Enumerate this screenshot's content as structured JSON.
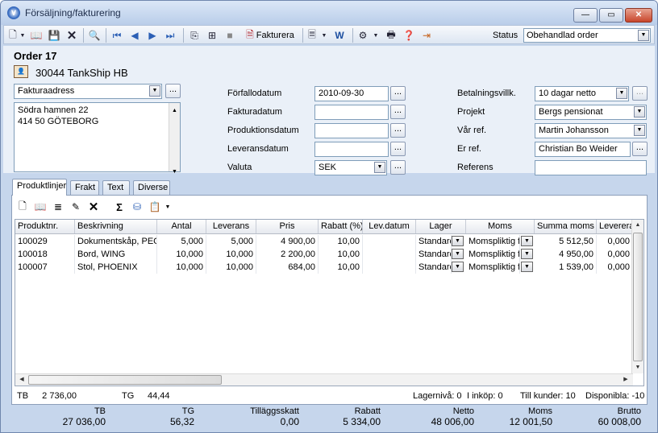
{
  "window": {
    "title": "Försäljning/fakturering",
    "minimize": "—",
    "maximize": "▭",
    "close": "✕"
  },
  "toolbar": {
    "invoice_label": "Fakturera",
    "status_label": "Status",
    "status_value": "Obehandlad order"
  },
  "order": {
    "title": "Order 17",
    "customer": "30044 TankShip HB"
  },
  "address": {
    "type": "Fakturaadress",
    "lines": [
      "Södra hamnen 22",
      "414 50 GÖTEBORG"
    ]
  },
  "dates": {
    "due_label": "Förfallodatum",
    "due_value": "2010-09-30",
    "invoice_label": "Fakturadatum",
    "invoice_value": "",
    "production_label": "Produktionsdatum",
    "production_value": "",
    "delivery_label": "Leveransdatum",
    "delivery_value": "",
    "currency_label": "Valuta",
    "currency_value": "SEK"
  },
  "terms": {
    "payment_label": "Betalningsvillk.",
    "payment_value": "10 dagar netto",
    "project_label": "Projekt",
    "project_value": "Bergs pensionat",
    "our_ref_label": "Vår ref.",
    "our_ref_value": "Martin Johansson",
    "your_ref_label": "Er ref.",
    "your_ref_value": "Christian Bo Weider",
    "reference_label": "Referens",
    "reference_value": ""
  },
  "tabs": [
    "Produktlinjer",
    "Frakt",
    "Text",
    "Diverse"
  ],
  "grid": {
    "columns": [
      "Produktnr.",
      "Beskrivning",
      "Antal",
      "Leverans",
      "Pris",
      "Rabatt (%)",
      "Lev.datum",
      "Lager",
      "Moms",
      "Summa moms",
      "Leverera"
    ],
    "rows": [
      {
        "nr": "100029",
        "desc": "Dokumentskåp, PEG",
        "qty": "5,000",
        "deliv": "5,000",
        "price": "4 900,00",
        "disc": "10,00",
        "date": "",
        "stock": "Standard",
        "vat": "Momspliktig fö",
        "vat_sum": "5 512,50",
        "todeliver": "0,000"
      },
      {
        "nr": "100018",
        "desc": "Bord, WING",
        "qty": "10,000",
        "deliv": "10,000",
        "price": "2 200,00",
        "disc": "10,00",
        "date": "",
        "stock": "Standard",
        "vat": "Momspliktig fö",
        "vat_sum": "4 950,00",
        "todeliver": "0,000"
      },
      {
        "nr": "100007",
        "desc": "Stol, PHOENIX",
        "qty": "10,000",
        "deliv": "10,000",
        "price": "684,00",
        "disc": "10,00",
        "date": "",
        "stock": "Standard",
        "vat": "Momspliktig fö",
        "vat_sum": "1 539,00",
        "todeliver": "0,000"
      }
    ]
  },
  "status_line": {
    "tb_label": "TB",
    "tb_value": "2 736,00",
    "tg_label": "TG",
    "tg_value": "44,44",
    "stock_level": "Lagernivå: 0",
    "in_purchase": "I inköp: 0",
    "to_customers": "Till kunder: 10",
    "available": "Disponibla: -10"
  },
  "totals": [
    {
      "label": "TB",
      "value": "27 036,00"
    },
    {
      "label": "TG",
      "value": "56,32"
    },
    {
      "label": "Tilläggsskatt",
      "value": "0,00"
    },
    {
      "label": "Rabatt",
      "value": "5 334,00"
    },
    {
      "label": "Netto",
      "value": "48 006,00"
    },
    {
      "label": "Moms",
      "value": "12 001,50"
    },
    {
      "label": "Brutto",
      "value": "60 008,00"
    }
  ]
}
